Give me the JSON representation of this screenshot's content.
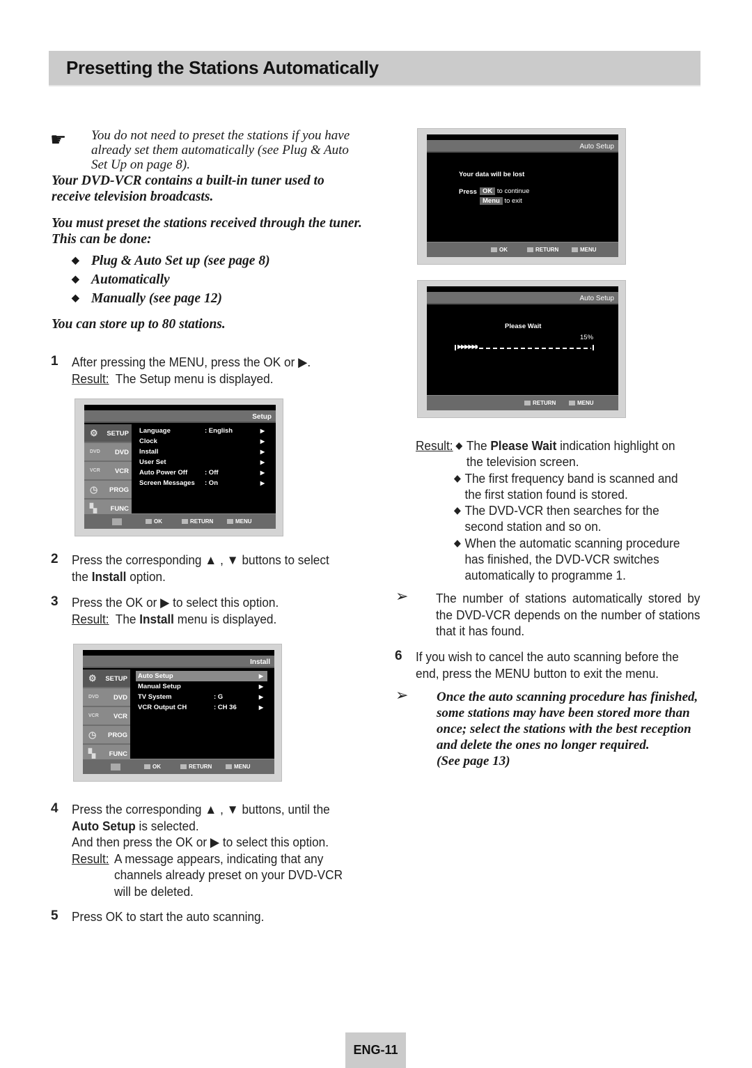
{
  "title": "Presetting the Stations Automatically",
  "intro": {
    "note": "You do not need to preset the stations if you have already set them automatically (see Plug & Auto Set Up on page 8).",
    "para1": "Your DVD-VCR contains a built-in tuner used to receive television broadcasts.",
    "para2": "You must preset the stations received through the tuner. This can be done:",
    "bullets": [
      "Plug & Auto Set up (see page 8)",
      "Automatically",
      "Manually (see page 12)"
    ],
    "para3": "You can store up to 80 stations."
  },
  "steps": {
    "s1": {
      "num": "1",
      "text": "After pressing the MENU, press the OK or ▶.",
      "result_label": "Result:",
      "result": "The Setup menu is displayed."
    },
    "s2": {
      "num": "2",
      "pre": "Press the corresponding ▲ , ▼ buttons to select the ",
      "bold": "Install",
      "post": " option."
    },
    "s3": {
      "num": "3",
      "text": "Press the OK or ▶ to select this option.",
      "result_label": "Result:",
      "result_pre": "The ",
      "result_bold": "Install",
      "result_post": " menu is displayed."
    },
    "s4": {
      "num": "4",
      "line1": "Press the corresponding ▲ , ▼ buttons, until the",
      "bold": "Auto Setup",
      "line2": " is selected.",
      "line3": "And then press the OK or ▶ to select this option.",
      "result_label": "Result:",
      "result": "A message appears, indicating that any channels already preset on your DVD-VCR will be deleted."
    },
    "s5": {
      "num": "5",
      "text": "Press OK to start the auto scanning."
    },
    "s6": {
      "num": "6",
      "text": "If you wish to cancel the auto scanning before the end, press the MENU button to exit the menu."
    }
  },
  "screen_setup": {
    "header": "Setup",
    "side": [
      "SETUP",
      "DVD",
      "VCR",
      "PROG",
      "FUNC"
    ],
    "rows": [
      {
        "label": "Language",
        "value": ": English"
      },
      {
        "label": "Clock",
        "value": ""
      },
      {
        "label": "Install",
        "value": ""
      },
      {
        "label": "User Set",
        "value": ""
      },
      {
        "label": "Auto Power Off",
        "value": ": Off"
      },
      {
        "label": "Screen Messages",
        "value": ": On"
      }
    ],
    "footer": {
      "ok": "OK",
      "ret": "RETURN",
      "menu": "MENU"
    }
  },
  "screen_install": {
    "header": "Install",
    "side": [
      "SETUP",
      "DVD",
      "VCR",
      "PROG",
      "FUNC"
    ],
    "rows": [
      {
        "label": "Auto Setup",
        "value": ""
      },
      {
        "label": "Manual Setup",
        "value": ""
      },
      {
        "label": "TV System",
        "value": ": G"
      },
      {
        "label": "VCR Output CH",
        "value": ": CH 36"
      }
    ],
    "footer": {
      "ok": "OK",
      "ret": "RETURN",
      "menu": "MENU"
    }
  },
  "screen_confirm": {
    "header": "Auto Setup",
    "line1": "Your data will be lost",
    "press": "Press",
    "ok_key": "OK",
    "ok_text": "to continue",
    "menu_key": "Menu",
    "menu_text": "to exit",
    "footer": {
      "ok": "OK",
      "ret": "RETURN",
      "menu": "MENU"
    }
  },
  "screen_wait": {
    "header": "Auto Setup",
    "message": "Please Wait",
    "percent_label": "15%",
    "progress": 0.15,
    "footer": {
      "ret": "RETURN",
      "menu": "MENU"
    }
  },
  "result_block": {
    "label": "Result:",
    "b1_pre": "The ",
    "b1_bold": "Please Wait",
    "b1_post": " indication highlight on the television screen.",
    "b2": "The first frequency band is scanned and the first station found is stored.",
    "b3": "The DVD-VCR then searches for the second station and so on.",
    "b4": "When the automatic scanning procedure has finished, the DVD-VCR switches automatically to programme 1."
  },
  "tip1": "The number of stations automatically stored by the DVD-VCR depends on the number of stations that it has found.",
  "tip2": "Once the auto scanning procedure has finished, some stations may have been stored more than once; select the stations with the best reception and delete the ones no longer required.",
  "tip2_ref": "(See page 13)",
  "page_number": "ENG-11"
}
